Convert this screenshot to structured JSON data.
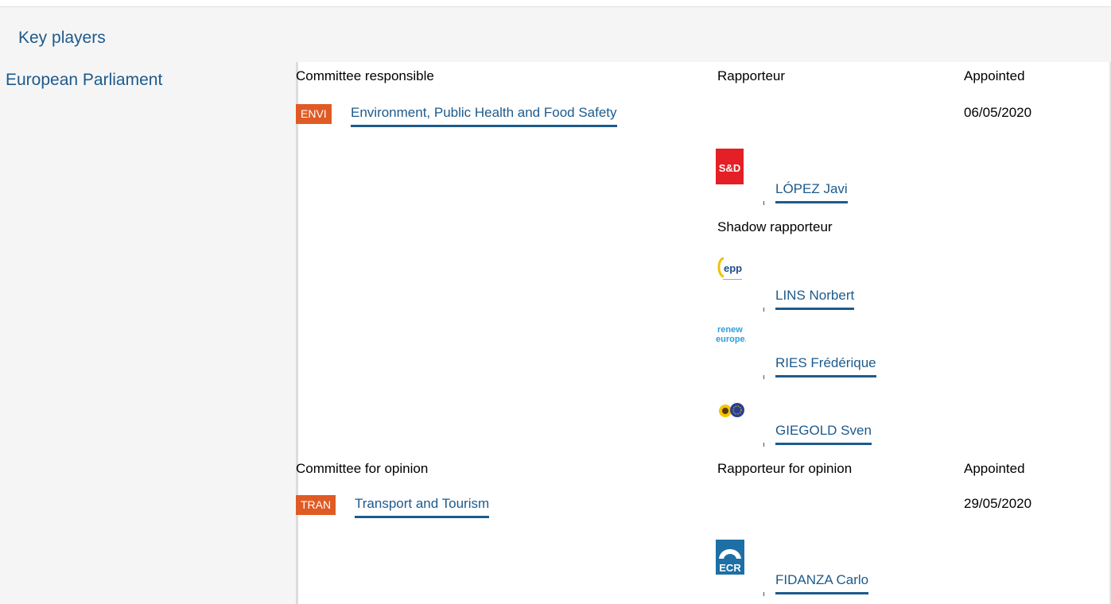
{
  "header": {
    "title": "Key players"
  },
  "institution": "European Parliament",
  "committee_responsible": {
    "heading": "Committee responsible",
    "rapporteur_heading": "Rapporteur",
    "appointed_heading": "Appointed",
    "badge": "ENVI",
    "name": "Environment, Public Health and Food Safety",
    "appointed_date": "06/05/2020",
    "rapporteur": {
      "group_logo": "S&D",
      "name": "LÓPEZ Javi"
    },
    "shadow_heading": "Shadow rapporteur",
    "shadows": [
      {
        "group_logo": "epp",
        "name": "LINS Norbert"
      },
      {
        "group_logo": "renew europe.",
        "name": "RIES Frédérique"
      },
      {
        "group_logo": "greens-efa-logo",
        "name": "GIEGOLD Sven"
      }
    ]
  },
  "committee_opinion": {
    "heading": "Committee for opinion",
    "rapporteur_heading": "Rapporteur for opinion",
    "appointed_heading": "Appointed",
    "badge": "TRAN",
    "name": "Transport and Tourism",
    "appointed_date": "29/05/2020",
    "rapporteur": {
      "group_logo": "ECR",
      "name": "FIDANZA Carlo"
    }
  },
  "colors": {
    "link": "#1d5a8c",
    "badge": "#e05b24",
    "panel_bg": "#f5f5f5"
  }
}
